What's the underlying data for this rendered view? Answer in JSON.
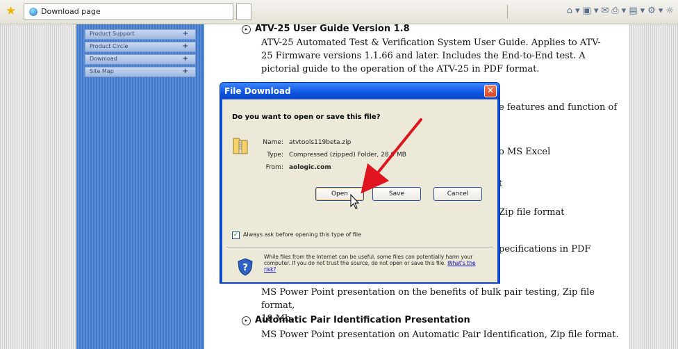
{
  "browser": {
    "tab_title": "Download page"
  },
  "sidebar": {
    "items": [
      {
        "label": "Product Support"
      },
      {
        "label": "Product Circle"
      },
      {
        "label": "Download"
      },
      {
        "label": "Site Map"
      }
    ]
  },
  "content": {
    "section1_heading": "ATV-25 User Guide Version 1.8",
    "section1_line1": "ATV-25 Automated Test & Verification System User Guide. Applies to ATV-",
    "section1_line2": "25 Firmware versions 1.1.66 and later. Includes the End-to-End test. A",
    "section1_line3": "pictorial guide to the operation of the ATV-25 in PDF format.",
    "frag_features": "e features and function of",
    "frag_excel": "o MS Excel",
    "frag_t": "t",
    "frag_zip": "Zip file format",
    "frag_specs": "pecifications in PDF",
    "section2_line1": "MS Power Point presentation on the benefits of bulk pair testing, Zip file format,",
    "section2_line2": "18 Mb.",
    "section3_heading": "Automatic Pair Identification Presentation",
    "section3_line1": "MS Power Point presentation on Automatic Pair Identification, Zip file format."
  },
  "dialog": {
    "title": "File Download",
    "question": "Do you want to open or save this file?",
    "name_label": "Name:",
    "name_value": "atvtools119beta.zip",
    "type_label": "Type:",
    "type_value": "Compressed (zipped) Folder, 28.9 MB",
    "from_label": "From:",
    "from_value": "aologic.com",
    "open_label": "Open",
    "save_label": "Save",
    "cancel_label": "Cancel",
    "checkbox_label": "Always ask before opening this type of file",
    "checkbox_checked": true,
    "warning_text": "While files from the Internet can be useful, some files can potentially harm your computer. If you do not trust the source, do not open or save this file.",
    "warning_link": "What's the risk?"
  },
  "annotation": {
    "arrow_color": "#e0141e"
  }
}
